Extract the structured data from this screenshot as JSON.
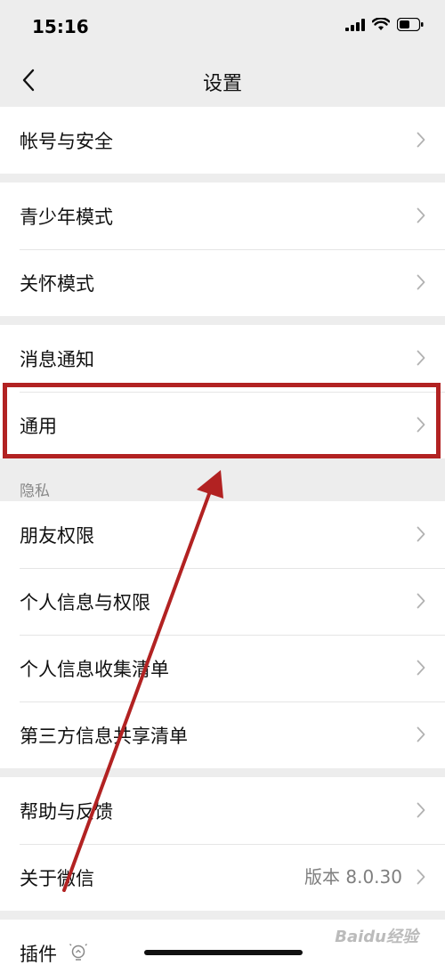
{
  "status_bar": {
    "time": "15:16"
  },
  "nav": {
    "title": "设置"
  },
  "groups": {
    "account": [
      {
        "label": "帐号与安全"
      }
    ],
    "modes": [
      {
        "label": "青少年模式"
      },
      {
        "label": "关怀模式"
      }
    ],
    "general": [
      {
        "label": "消息通知"
      },
      {
        "label": "通用"
      }
    ],
    "privacy": {
      "section_label": "隐私",
      "items": [
        {
          "label": "朋友权限"
        },
        {
          "label": "个人信息与权限"
        },
        {
          "label": "个人信息收集清单"
        },
        {
          "label": "第三方信息共享清单"
        }
      ]
    },
    "about": [
      {
        "label": "帮助与反馈"
      },
      {
        "label": "关于微信",
        "value": "版本 8.0.30"
      }
    ],
    "plugins": [
      {
        "label": "插件"
      }
    ]
  },
  "watermark": {
    "text": "Baidu经验"
  },
  "colors": {
    "annotation": "#b22222",
    "background": "#ededed",
    "chevron": "#b2b2b2"
  }
}
